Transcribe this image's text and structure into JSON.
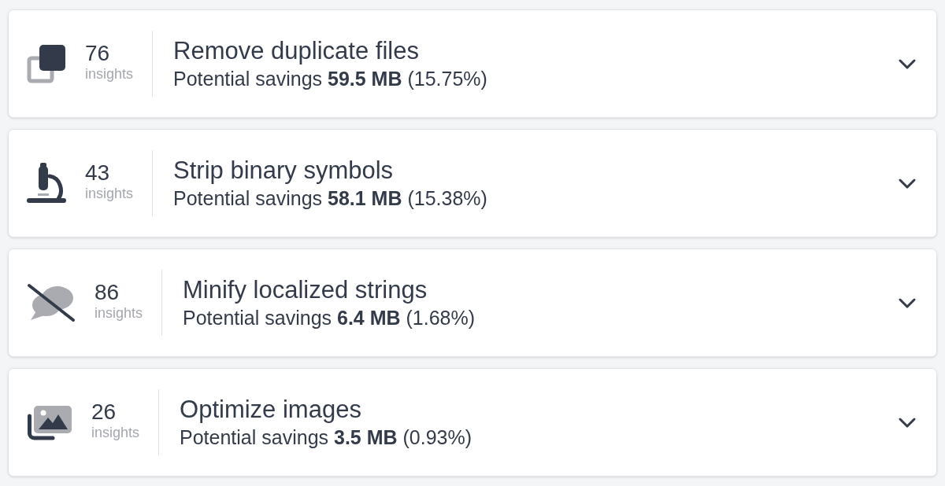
{
  "insights": [
    {
      "kind": "duplicates",
      "count": "76",
      "count_label": "insights",
      "title": "Remove duplicate files",
      "savings": "Potential savings **59.5 MB** (15.75%)",
      "expanded": false
    },
    {
      "kind": "symbols",
      "count": "43",
      "count_label": "insights",
      "title": "Strip binary symbols",
      "savings": "Potential savings **58.1 MB** (15.38%)",
      "expanded": false
    },
    {
      "kind": "strings",
      "count": "86",
      "count_label": "insights",
      "title": "Minify localized strings",
      "savings": "Potential savings **6.4 MB** (1.68%)",
      "expanded": false
    },
    {
      "kind": "images",
      "count": "26",
      "count_label": "insights",
      "title": "Optimize images",
      "savings": "Potential savings **3.5 MB** (0.93%)",
      "expanded": false
    }
  ]
}
